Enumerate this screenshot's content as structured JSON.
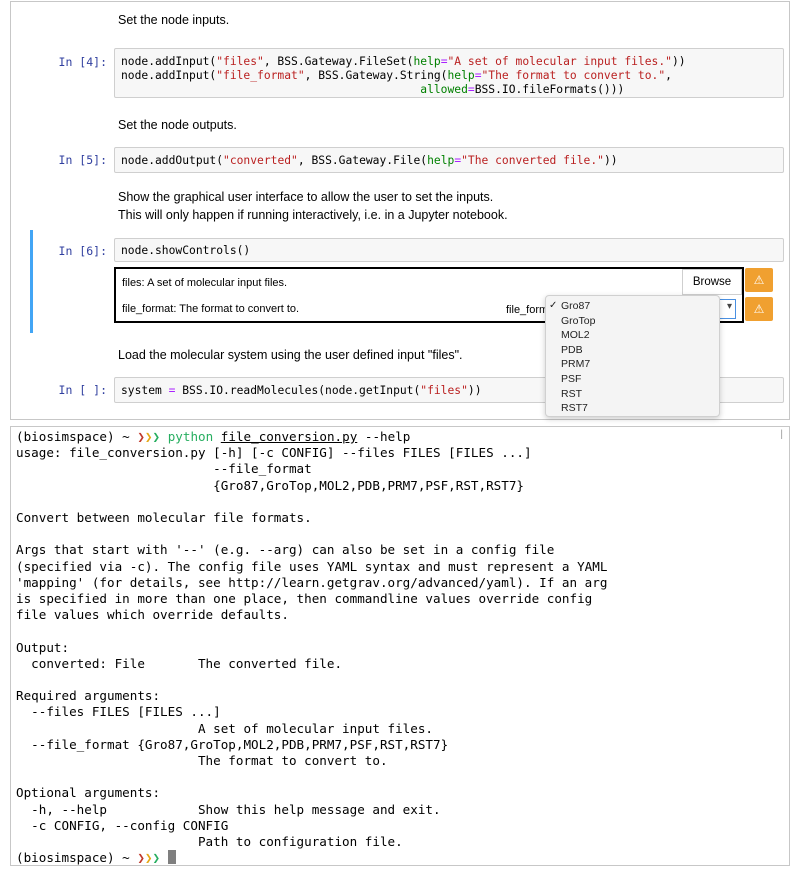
{
  "notebook": {
    "md1": "Set the node inputs.",
    "cell4": {
      "prompt": "In [4]:",
      "l1_a": "node.addInput(",
      "l1_s1": "\"files\"",
      "l1_b": ", BSS.Gateway.FileSet(",
      "l1_kw": "help",
      "l1_eq": "=",
      "l1_s2": "\"A set of molecular input files.\"",
      "l1_c": "))",
      "l2_a": "node.addInput(",
      "l2_s1": "\"file_format\"",
      "l2_b": ", BSS.Gateway.String(",
      "l2_kw": "help",
      "l2_eq": "=",
      "l2_s2": "\"The format to convert to.\"",
      "l2_c": ",",
      "l3_pad": "                                            ",
      "l3_kw": "allowed",
      "l3_eq": "=",
      "l3_c": "BSS.IO.fileFormats()))"
    },
    "md2": "Set the node outputs.",
    "cell5": {
      "prompt": "In [5]:",
      "a": "node.addOutput(",
      "s1": "\"converted\"",
      "b": ", BSS.Gateway.File(",
      "kw": "help",
      "eq": "=",
      "s2": "\"The converted file.\"",
      "c": "))"
    },
    "md3_l1": "Show the graphical user interface to allow the user to set the inputs.",
    "md3_l2": "This will only happen if running interactively, i.e. in a Jupyter notebook.",
    "cell6": {
      "prompt": "In [6]:",
      "code": "node.showControls()"
    },
    "widget": {
      "files_label": "files: A set of molecular input files.",
      "browse_label": "Browse",
      "format_label": "file_format: The format to convert to.",
      "dropdown_label": "file_format",
      "warn_icon": "⚠",
      "options": [
        "Gro87",
        "GroTop",
        "MOL2",
        "PDB",
        "PRM7",
        "PSF",
        "RST",
        "RST7"
      ],
      "selected": "Gro87"
    },
    "md4": "Load the molecular system using the user defined input \"files\".",
    "cell7": {
      "prompt": "In [ ]:",
      "a": "system ",
      "op": "=",
      "b": " BSS.IO.readMolecules(node.getInput(",
      "s1": "\"files\"",
      "c": "))"
    }
  },
  "terminal": {
    "env": "(biosimspace)",
    "tilde": " ~ ",
    "arrows": [
      "❯",
      "❯",
      "❯"
    ],
    "cmd_python": "python",
    "cmd_file": "file_conversion.py",
    "cmd_args": " --help",
    "lines": [
      "usage: file_conversion.py [-h] [-c CONFIG] --files FILES [FILES ...]",
      "                          --file_format",
      "                          {Gro87,GroTop,MOL2,PDB,PRM7,PSF,RST,RST7}",
      "",
      "Convert between molecular file formats.",
      "",
      "Args that start with '--' (e.g. --arg) can also be set in a config file",
      "(specified via -c). The config file uses YAML syntax and must represent a YAML",
      "'mapping' (for details, see http://learn.getgrav.org/advanced/yaml). If an arg",
      "is specified in more than one place, then commandline values override config",
      "file values which override defaults.",
      "",
      "Output:",
      "  converted: File       The converted file.",
      "",
      "Required arguments:",
      "  --files FILES [FILES ...]",
      "                        A set of molecular input files.",
      "  --file_format {Gro87,GroTop,MOL2,PDB,PRM7,PSF,RST,RST7}",
      "                        The format to convert to.",
      "",
      "Optional arguments:",
      "  -h, --help            Show this help message and exit.",
      "  -c CONFIG, --config CONFIG",
      "                        Path to configuration file."
    ]
  }
}
